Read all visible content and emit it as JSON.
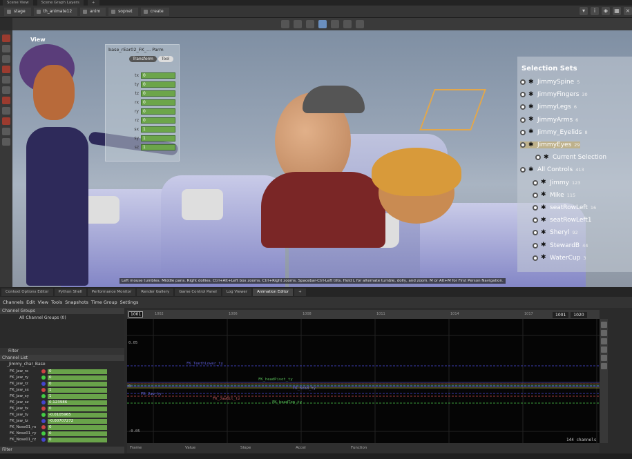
{
  "top_tabs": [
    "Scene View",
    "Scene Graph Layers",
    "+"
  ],
  "path": [
    "stage",
    "th_animate12",
    "anim",
    "sopnet",
    "create"
  ],
  "viewport": {
    "label": "View",
    "hint": "Left mouse tumbles. Middle pans. Right dollies. Ctrl+Alt+Left box zooms. Ctrl+Right zooms. Spacebar-Ctrl-Left tilts. Hold L for alternate tumble, dolly, and zoom. M or Alt+M for First Person Navigation."
  },
  "parm": {
    "title": "base_rEar02_FK_...  Parm",
    "tabs": [
      "Transform",
      "Tool"
    ],
    "rows": [
      {
        "label": "tx",
        "value": "0"
      },
      {
        "label": "ty",
        "value": "0"
      },
      {
        "label": "tz",
        "value": "0"
      },
      {
        "label": "rx",
        "value": "0"
      },
      {
        "label": "ry",
        "value": "0"
      },
      {
        "label": "rz",
        "value": "0"
      },
      {
        "label": "sx",
        "value": "1"
      },
      {
        "label": "sy",
        "value": "1"
      },
      {
        "label": "sz",
        "value": "1"
      }
    ]
  },
  "selection_sets": {
    "title": "Selection Sets",
    "items": [
      {
        "name": "JimmySpine",
        "count": "5"
      },
      {
        "name": "JimmyFingers",
        "count": "30"
      },
      {
        "name": "JimmyLegs",
        "count": "6"
      },
      {
        "name": "JimmyArms",
        "count": "6"
      },
      {
        "name": "Jimmy_Eyelids",
        "count": "8"
      },
      {
        "name": "JimmyEyes",
        "count": "29"
      },
      {
        "name": "Current Selection",
        "count": ""
      },
      {
        "name": "All Controls",
        "count": "413"
      },
      {
        "name": "Jimmy",
        "count": "123"
      },
      {
        "name": "Mike",
        "count": "115"
      },
      {
        "name": "seatRowLeft",
        "count": "16"
      },
      {
        "name": "seatRowLeft1",
        "count": ""
      },
      {
        "name": "Sheryl",
        "count": "92"
      },
      {
        "name": "StewardB",
        "count": "44"
      },
      {
        "name": "WaterCup",
        "count": "3"
      }
    ]
  },
  "pane_tabs": [
    "Context Options Editor",
    "Python Shell",
    "Performance Monitor",
    "Render Gallery",
    "Game Control Panel",
    "Log Viewer",
    "Animation Editor",
    "+"
  ],
  "anim_menu": [
    "Channels",
    "Edit",
    "View",
    "Tools",
    "Snapshots",
    "Time Group",
    "Settings"
  ],
  "channel_groups": {
    "header": "Channel Groups",
    "item": "All Channel Groups (0)"
  },
  "filter_label": "Filter",
  "channel_list": {
    "header": "Channel List",
    "root": "_Jimmy_char_Base",
    "rows": [
      {
        "name": "FK_Jaw_rx",
        "value": "0",
        "color": "#c44"
      },
      {
        "name": "FK_Jaw_ry",
        "value": "0",
        "color": "#4c4"
      },
      {
        "name": "FK_Jaw_rz",
        "value": "0",
        "color": "#44c"
      },
      {
        "name": "FK_Jaw_sx",
        "value": "1",
        "color": "#c44"
      },
      {
        "name": "FK_Jaw_sy",
        "value": "1",
        "color": "#4c4"
      },
      {
        "name": "FK_Jaw_sz",
        "value": "0.123986",
        "color": "#44c"
      },
      {
        "name": "FK_Jaw_tx",
        "value": "0",
        "color": "#c44"
      },
      {
        "name": "FK_Jaw_ty",
        "value": "-0.0105965",
        "color": "#4c4"
      },
      {
        "name": "FK_Jaw_tz",
        "value": "-0.00707272",
        "color": "#44c"
      },
      {
        "name": "FK_Nose01_rx",
        "value": "0",
        "color": "#c44"
      },
      {
        "name": "FK_Nose01_ry",
        "value": "0",
        "color": "#4c4"
      },
      {
        "name": "FK_Nose01_rz",
        "value": "0",
        "color": "#44c"
      }
    ]
  },
  "graph": {
    "current_frame": "1001",
    "range_start": "1001",
    "range_end": "1020",
    "ticks": [
      "1002",
      "1006",
      "1008",
      "1011",
      "1014",
      "1017"
    ],
    "y_top": "0.05",
    "y_mid": "0",
    "y_bot": "-0.05",
    "channel_count": "144 channels",
    "curve_labels": [
      "FK_TeethLower_ty",
      "FK_headPivot_ty",
      "FK_Jaw_ty",
      "FK_head_ty",
      "FK_JawBit_tz",
      "FK_headTop_ty"
    ]
  },
  "bottom_fields": [
    "Frame",
    "Value",
    "Slope",
    "Accel",
    "Function"
  ],
  "colors": {
    "accent": "#6a8fbf",
    "value_green": "#69a34a"
  }
}
